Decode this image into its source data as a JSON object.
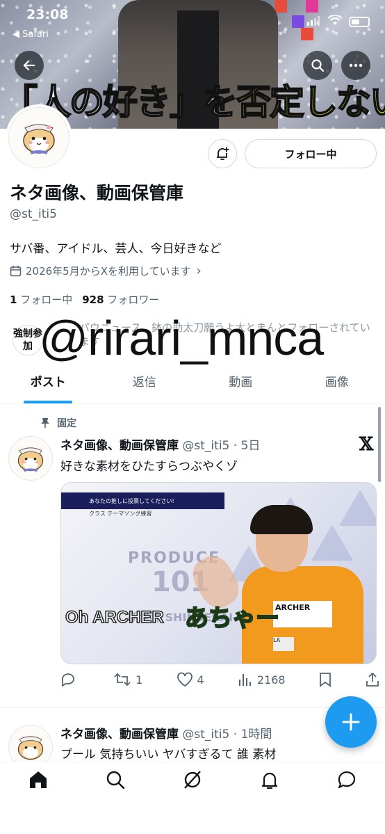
{
  "status": {
    "time": "23:08",
    "back_label": "◀ Safari"
  },
  "banner": {
    "caption_part1": "「人の好き」を",
    "caption_part2": "否定しない"
  },
  "profile": {
    "display_name": "ネタ画像、動画保管庫",
    "handle": "@st_iti5",
    "bio": "サバ番、アイドル、芸人、今日好きなど",
    "joined": "2026年5月からXを利用しています",
    "following_count": "1",
    "following_label": "フォロー中",
    "followers_count": "928",
    "followers_label": "フォロワー",
    "follow_button": "フォロー中",
    "known_followers_text": "パウニュース、鉢の助太刀願うよ太とまんとフォローされています",
    "known_avatar_text": "強制参加"
  },
  "watermark": "@rirari_mnca",
  "tabs": [
    "ポスト",
    "返信",
    "動画",
    "画像"
  ],
  "posts": [
    {
      "pinned_label": "固定",
      "name": "ネタ画像、動画保管庫",
      "meta": "@st_iti5 · 5日",
      "text": "好きな素材をひたすらつぶやくゾ",
      "media": {
        "banner_text": "あなたの推しに投票してください!",
        "sub_text": "クラス テーマソング練習",
        "program": "PRODUCE",
        "program_num": "101",
        "program_sub": "新世界 SHINSEKAI",
        "caption_en": "Oh ARCHER",
        "caption_jp": "あちゃー",
        "name_tag": "ARCHER",
        "tag_code": "LA"
      },
      "replies": "",
      "reposts": "1",
      "likes": "4",
      "views": "2168"
    },
    {
      "name": "ネタ画像、動画保管庫",
      "meta": "@st_iti5 · 1時間",
      "text": "プール 気持ちいい ヤバすぎるて 誰 素材"
    }
  ],
  "colors": {
    "accent": "#1d9bf0",
    "text": "#0f1419",
    "muted": "#536471",
    "caption_yellow": "#f3f025"
  }
}
